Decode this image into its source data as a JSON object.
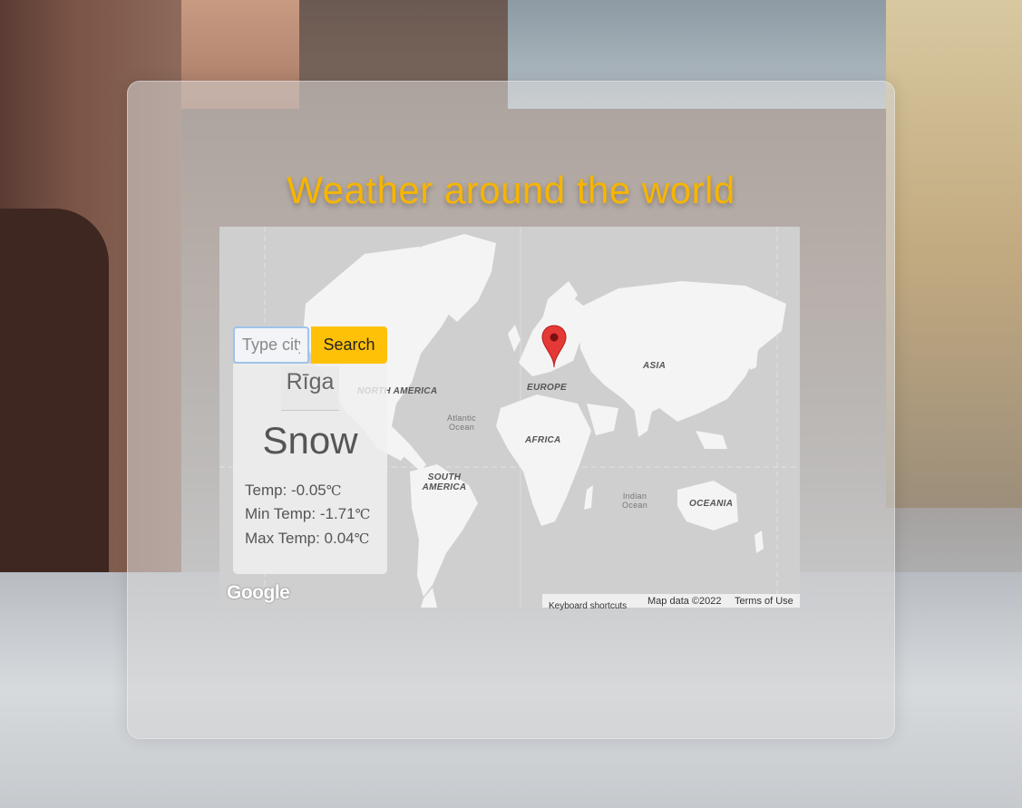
{
  "page": {
    "title": "Weather around the world"
  },
  "search": {
    "placeholder": "Type city",
    "button_label": "Search"
  },
  "weather": {
    "city": "Rīga",
    "condition": "Snow",
    "temp_label": "Temp: -0.05",
    "min_temp_label": "Min Temp: -1.71",
    "max_temp_label": "Max Temp: 0.04",
    "unit": "℃"
  },
  "map": {
    "labels": {
      "north_america": "NORTH AMERICA",
      "europe": "EUROPE",
      "asia": "ASIA",
      "africa": "AFRICA",
      "south_america": "SOUTH AMERICA",
      "oceania": "OCEANIA",
      "atlantic": "Atlantic Ocean",
      "indian": "Indian Ocean"
    },
    "logo": "Google",
    "attribution": {
      "shortcuts": "Keyboard shortcuts",
      "data": "Map data ©2022",
      "terms": "Terms of Use"
    },
    "marker_icon": "map-pin-icon"
  },
  "colors": {
    "title": "#f7b500",
    "button": "#ffc107",
    "marker": "#e53935",
    "land": "#f4f4f4",
    "water": "#cfcfcf"
  }
}
